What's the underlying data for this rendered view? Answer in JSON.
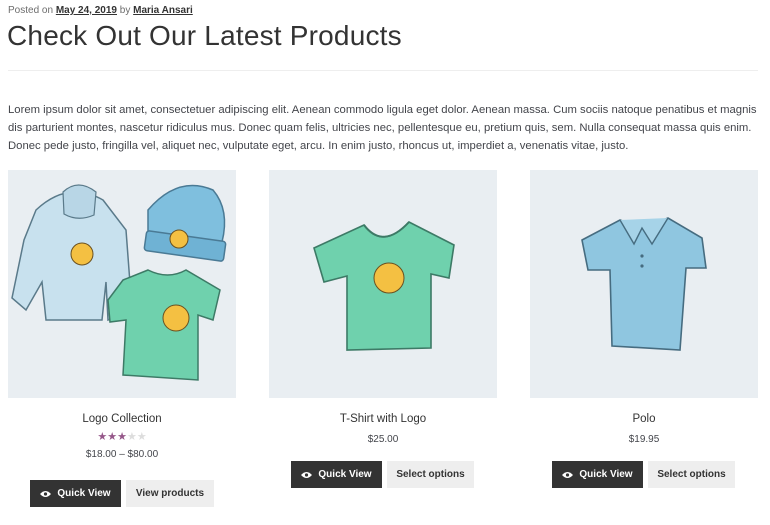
{
  "post_meta": {
    "prefix": "Posted on",
    "date": "May 24, 2019",
    "by": "by",
    "author": "Maria Ansari"
  },
  "page_title": "Check Out Our Latest Products",
  "intro_text": "Lorem ipsum dolor sit amet, consectetuer adipiscing elit. Aenean commodo ligula eget dolor. Aenean massa. Cum sociis natoque penatibus et magnis dis parturient montes, nascetur ridiculus mus. Donec quam felis, ultricies nec, pellentesque eu, pretium quis, sem. Nulla consequat massa quis enim. Donec pede justo, fringilla vel, aliquet nec, vulputate eget, arcu. In enim justo, rhoncus ut, imperdiet a, venenatis vitae, justo.",
  "colors": {
    "rating": "#96588a",
    "button_dark": "#333333",
    "button_light": "#eeeeee",
    "image_bg": "#e9eef2",
    "teal_shirt": "#6fd1ad",
    "blue_item": "#8fc6e0"
  },
  "products": [
    {
      "name": "Logo Collection",
      "rating": 3,
      "rating_max": 5,
      "price": "$18.00 – $80.00",
      "quick_view": "Quick View",
      "action": "View products",
      "image": "logo-collection-image"
    },
    {
      "name": "T-Shirt with Logo",
      "price": "$25.00",
      "quick_view": "Quick View",
      "action": "Select options",
      "image": "tshirt-image"
    },
    {
      "name": "Polo",
      "price": "$19.95",
      "quick_view": "Quick View",
      "action": "Select options",
      "image": "polo-image"
    }
  ]
}
